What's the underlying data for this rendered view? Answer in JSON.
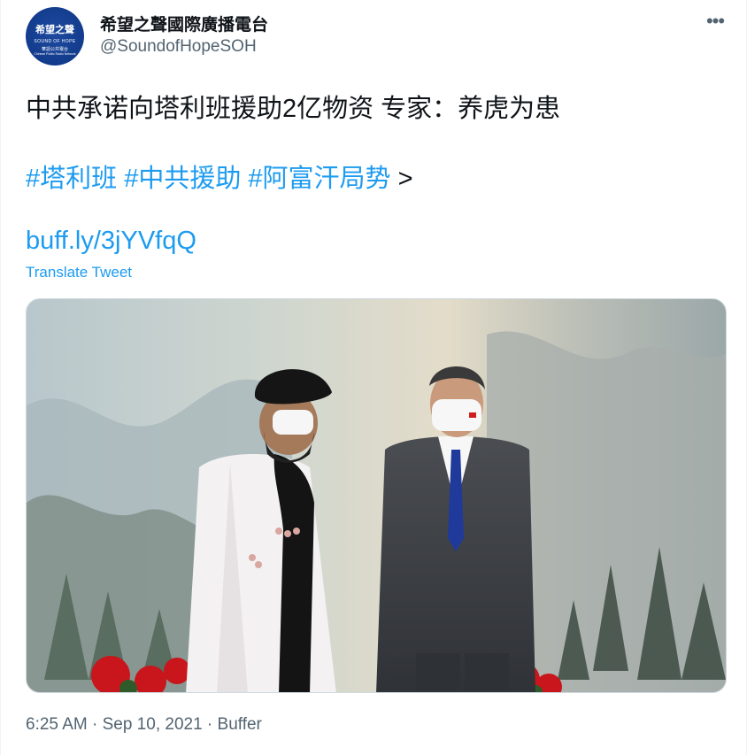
{
  "tweet": {
    "author": {
      "display_name": "希望之聲國際廣播電台",
      "handle": "@SoundofHopeSOH",
      "avatar": {
        "logo_cjk": "希望之聲",
        "logo_en": "SOUND OF HOPE",
        "logo_sub": "華語公共電台",
        "logo_sub2": "Chinese Public Radio Network"
      }
    },
    "text_line1": "中共承诺向塔利班援助2亿物资 专家：养虎为患",
    "hashtags": [
      "#塔利班",
      "#中共援助",
      "#阿富汗局势"
    ],
    "hashtag_suffix": " >",
    "link": "buff.ly/3jYVfqQ",
    "translate_label": "Translate Tweet",
    "media_icon": "photo-two-men-standing",
    "meta": "6:25 AM · Sep 10, 2021 · Buffer",
    "more_icon": "more-horizontal-icon"
  },
  "colors": {
    "link": "#1d9bf0",
    "secondary": "#536471",
    "text": "#0f1419"
  }
}
